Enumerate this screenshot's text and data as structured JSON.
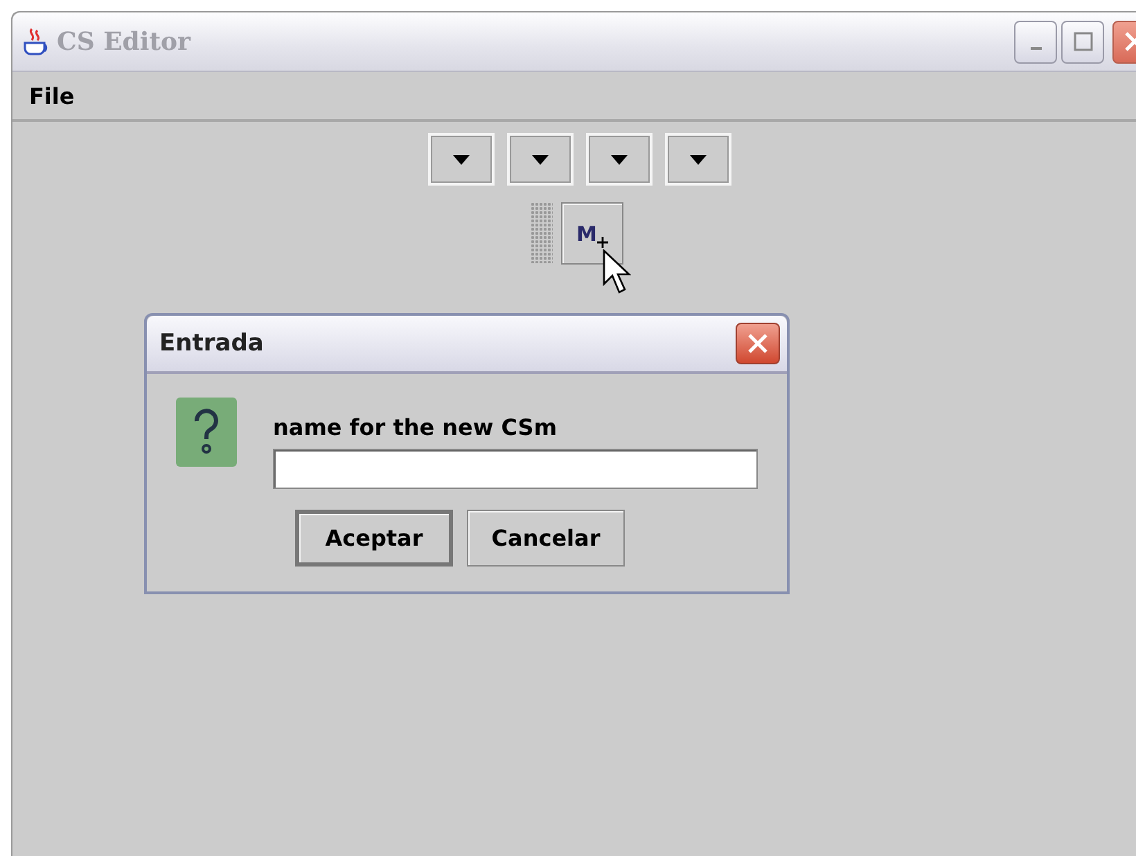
{
  "window": {
    "title": "CS Editor"
  },
  "menu": [
    {
      "label": "File"
    }
  ],
  "dropdown_buttons": [
    {
      "kind": "dropdown"
    },
    {
      "kind": "dropdown"
    },
    {
      "kind": "dropdown"
    },
    {
      "kind": "dropdown"
    }
  ],
  "toolbar": {
    "button_label": "M"
  },
  "dialog": {
    "title": "Entrada",
    "message": "name for the new CSm",
    "buttons": [
      {
        "label": "Aceptar",
        "default": true
      },
      {
        "label": "Cancelar",
        "default": false
      }
    ]
  }
}
